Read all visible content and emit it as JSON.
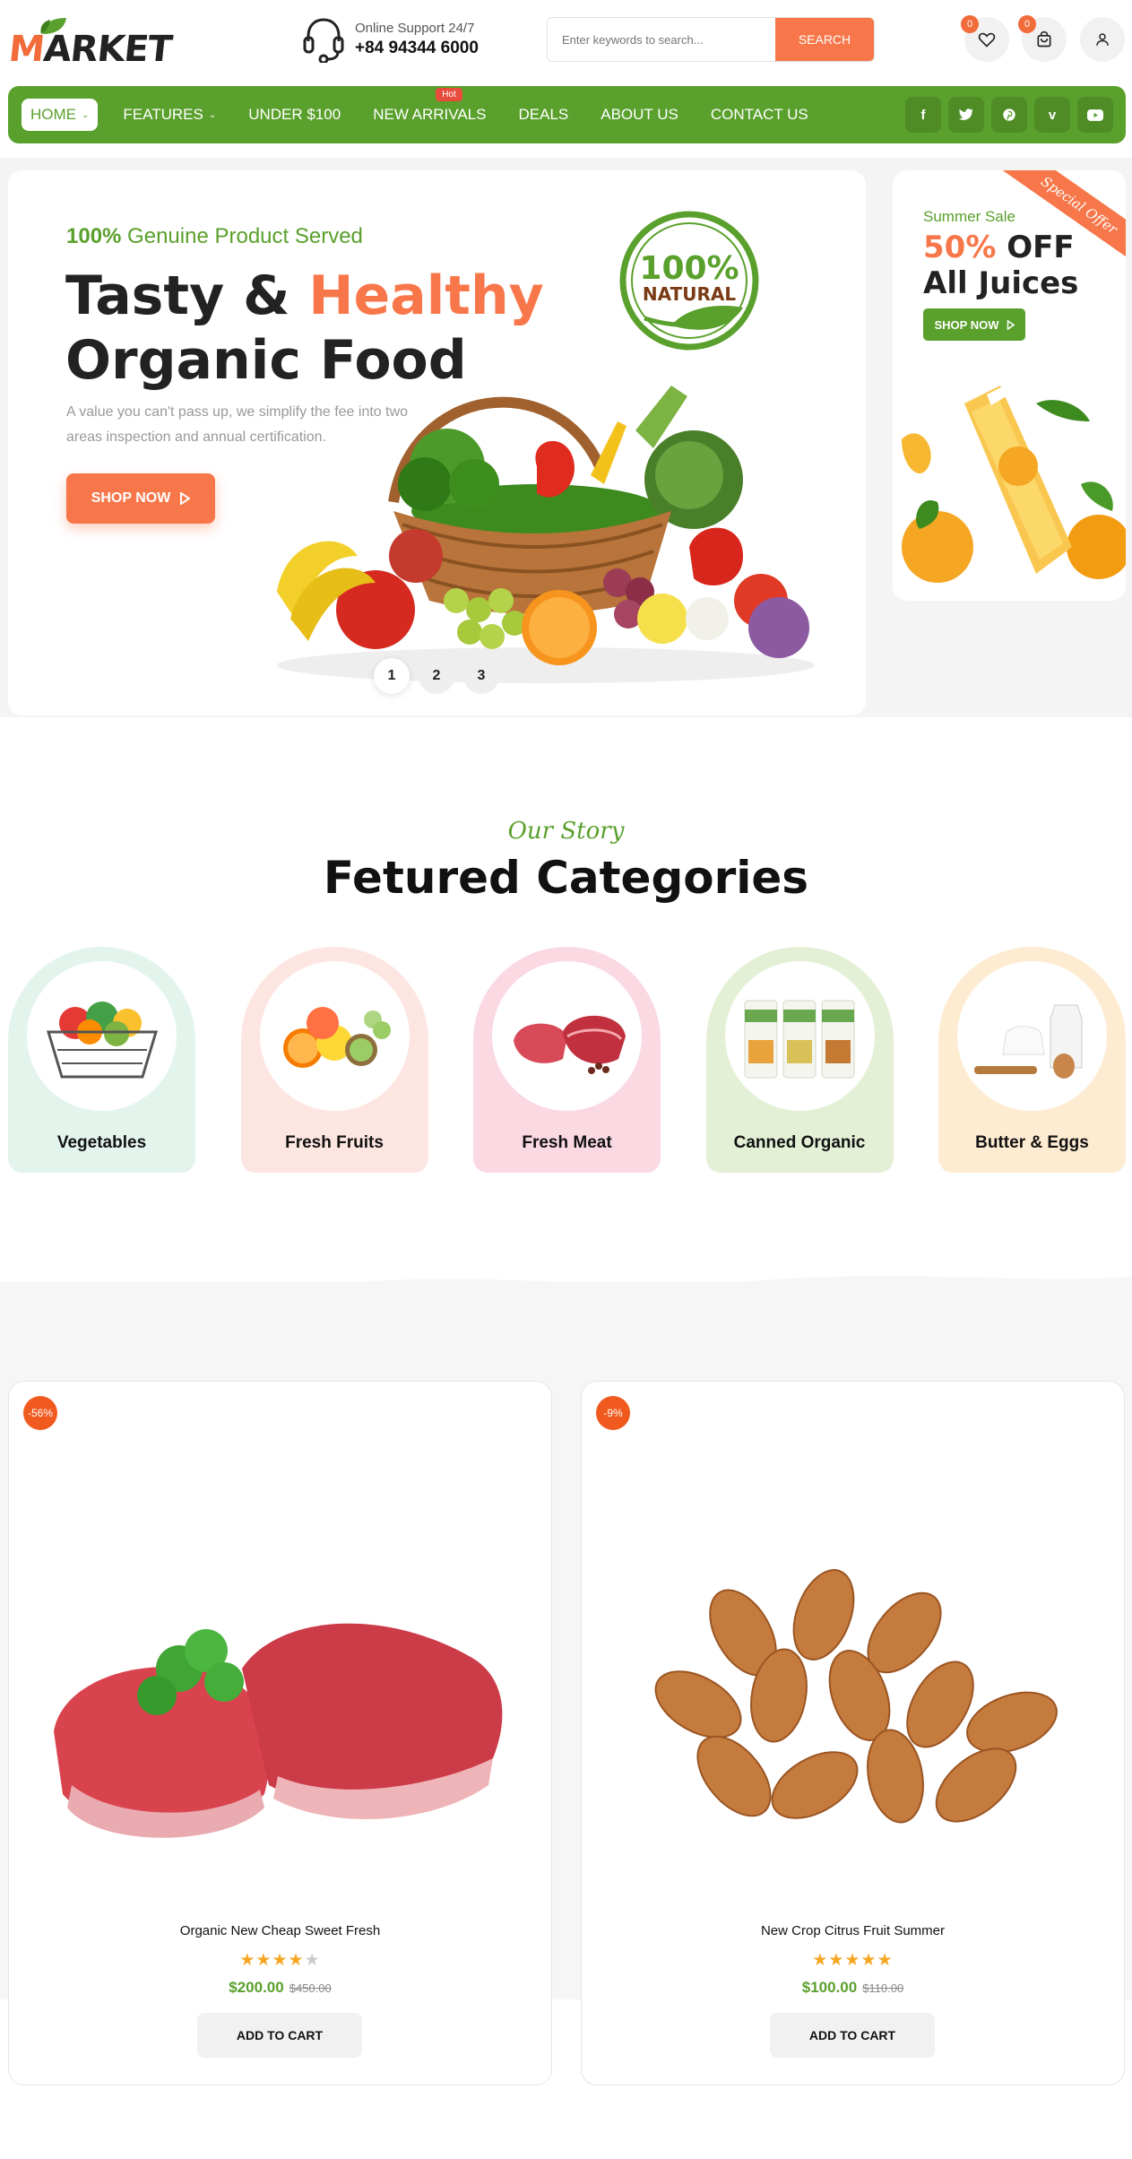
{
  "header": {
    "logo_text_first": "M",
    "logo_text_rest": "ARKET",
    "support_line1": "Online Support 24/7",
    "support_phone": "+84 94344 6000",
    "search_placeholder": "Enter keywords to search...",
    "search_button": "SEARCH",
    "wishlist_count": "0",
    "cart_count": "0"
  },
  "nav": {
    "items": [
      {
        "label": "HOME",
        "dropdown": true
      },
      {
        "label": "FEATURES",
        "dropdown": true
      },
      {
        "label": "UNDER $100"
      },
      {
        "label": "NEW ARRIVALS",
        "tag": "Hot"
      },
      {
        "label": "DEALS"
      },
      {
        "label": "ABOUT US"
      },
      {
        "label": "CONTACT US"
      }
    ],
    "socials": [
      "facebook-icon",
      "twitter-icon",
      "pinterest-icon",
      "vimeo-icon",
      "youtube-icon"
    ]
  },
  "hero": {
    "sub_bold": "100%",
    "sub_rest": " Genuine Product Served",
    "title_part1": "Tasty & ",
    "title_highlight": "Healthy",
    "title_line2": "Organic Food",
    "description": "A value you can't pass up, we simplify the fee into two areas inspection and annual certification.",
    "button": "SHOP NOW",
    "badge_line1": "100%",
    "badge_line2": "NATURAL",
    "slides": [
      "1",
      "2",
      "3"
    ],
    "active_slide": 0
  },
  "promo": {
    "ribbon": "Special Offer",
    "sub": "Summer Sale",
    "title_highlight": "50%",
    "title_rest": " OFF",
    "title_line2": "All Juices",
    "button": "SHOP NOW"
  },
  "categories": {
    "kicker": "Our Story",
    "title": "Fetured Categories",
    "items": [
      {
        "label": "Vegetables",
        "bg": "#e3f4ec"
      },
      {
        "label": "Fresh Fruits",
        "bg": "#fde6e1"
      },
      {
        "label": "Fresh Meat",
        "bg": "#fbd9e3"
      },
      {
        "label": "Canned Organic",
        "bg": "#e3f0d6"
      },
      {
        "label": "Butter & Eggs",
        "bg": "#feecd2"
      }
    ]
  },
  "products": [
    {
      "discount": "-56%",
      "name": "Organic New Cheap Sweet Fresh",
      "rating": 4,
      "price": "$200.00",
      "old_price": "$450.00",
      "button": "ADD TO CART"
    },
    {
      "discount": "-9%",
      "name": "New Crop Citrus Fruit Summer",
      "rating": 5,
      "price": "$100.00",
      "old_price": "$110.00",
      "button": "ADD TO CART"
    }
  ],
  "colors": {
    "brand_green": "#5aa02c",
    "accent_orange": "#f7774a",
    "discount_red": "#f15a1f"
  }
}
